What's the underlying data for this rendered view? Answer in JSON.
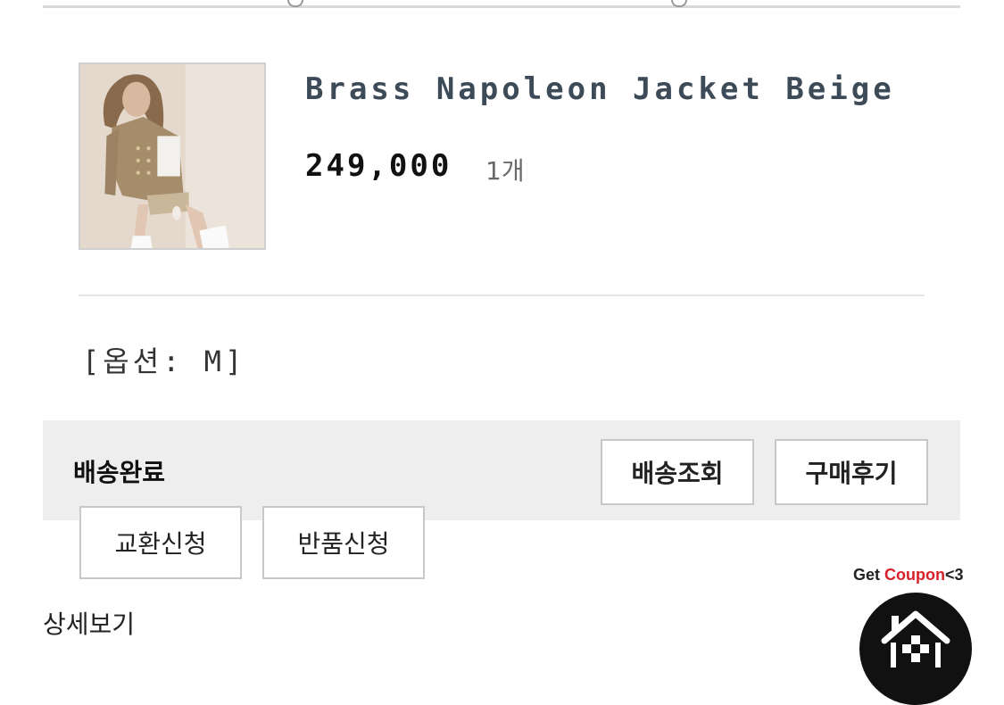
{
  "order_item": {
    "product_name": "Brass Napoleon Jacket Beige",
    "price": "249,000",
    "quantity": "1개",
    "option": "[옵션: M]"
  },
  "shipping": {
    "status": "배송완료",
    "track_label": "배송조회",
    "review_label": "구매후기"
  },
  "actions": {
    "exchange_label": "교환신청",
    "return_label": "반품신청",
    "detail_label": "상세보기"
  },
  "coupon": {
    "text_get": "Get ",
    "text_coupon": "Coupon",
    "text_heart": "<3"
  },
  "colors": {
    "accent_red": "#d6212a",
    "status_bar_bg": "#eeeeee"
  }
}
